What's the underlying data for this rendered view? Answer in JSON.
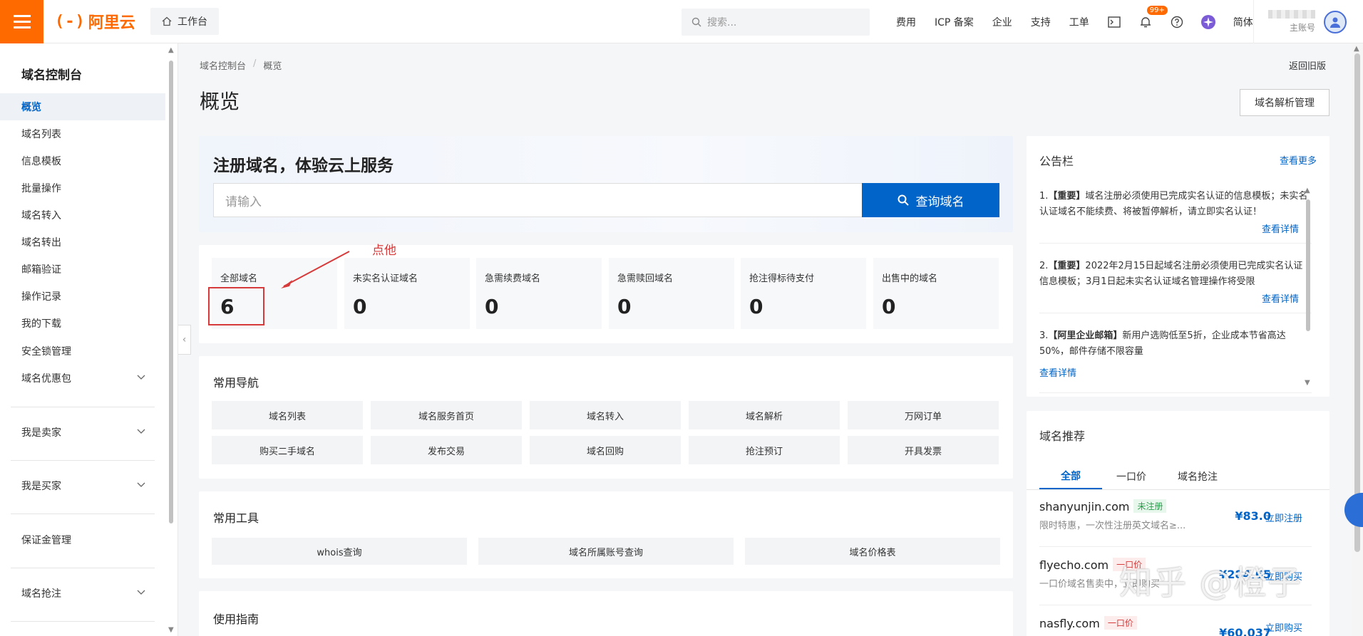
{
  "topbar": {
    "logo_mark": "(-)",
    "logo_text": "阿里云",
    "workbench": "工作台",
    "search_placeholder": "搜索...",
    "links": [
      "费用",
      "ICP 备案",
      "企业",
      "支持",
      "工单"
    ],
    "badge": "99+",
    "language": "简体",
    "account_role": "主账号"
  },
  "sidebar": {
    "title": "域名控制台",
    "items": [
      "概览",
      "域名列表",
      "信息模板",
      "批量操作",
      "域名转入",
      "域名转出",
      "邮箱验证",
      "操作记录",
      "我的下载",
      "安全锁管理",
      "域名优惠包"
    ],
    "groups": [
      "我是卖家",
      "我是买家",
      "保证金管理",
      "域名抢注"
    ],
    "collapse_glyph": "‹"
  },
  "main": {
    "breadcrumb": [
      "域名控制台",
      "/",
      "概览"
    ],
    "back_old": "返回旧版",
    "title": "概览",
    "dns_button": "域名解析管理",
    "register": {
      "title": "注册域名，体验云上服务",
      "placeholder": "请输入",
      "button": "查询域名"
    },
    "stats": [
      {
        "label": "全部域名",
        "value": "6"
      },
      {
        "label": "未实名认证域名",
        "value": "0"
      },
      {
        "label": "急需续费域名",
        "value": "0"
      },
      {
        "label": "急需赎回域名",
        "value": "0"
      },
      {
        "label": "抢注得标待支付",
        "value": "0"
      },
      {
        "label": "出售中的域名",
        "value": "0"
      }
    ],
    "annotation": "点他",
    "nav": {
      "title": "常用导航",
      "items": [
        "域名列表",
        "域名服务首页",
        "域名转入",
        "域名解析",
        "万网订单",
        "购买二手域名",
        "发布交易",
        "域名回购",
        "抢注预订",
        "开具发票"
      ]
    },
    "tools": {
      "title": "常用工具",
      "items": [
        "whois查询",
        "域名所属账号查询",
        "域名价格表"
      ]
    },
    "guide": {
      "title": "使用指南"
    }
  },
  "notice": {
    "title": "公告栏",
    "more": "查看更多",
    "detail": "查看详情",
    "items": [
      {
        "prefix": "1.",
        "tag": "【重要】",
        "text": "域名注册必须使用已完成实名认证的信息模板；未实名认证域名不能续费、将被暂停解析，请立即实名认证！"
      },
      {
        "prefix": "2.",
        "tag": "【重要】",
        "text": "2022年2月15日起域名注册必须使用已完成实名认证信息模板；3月1日起未实名认证域名管理操作将受限"
      },
      {
        "prefix": "3.",
        "tag": "【阿里企业邮箱】",
        "text": "新用户选购低至5折，企业成本节省高达50%，邮件存储不限容量"
      }
    ]
  },
  "recommend": {
    "title": "域名推荐",
    "tabs": [
      "全部",
      "一口价",
      "域名抢注"
    ],
    "rows": [
      {
        "domain": "shanyunjin.com",
        "tag": "未注册",
        "desc": "限时特惠，一次性注册英文域名≥...",
        "price": "¥83.0",
        "action": "立即注册"
      },
      {
        "domain": "flyecho.com",
        "tag": "一口价",
        "desc": "一口价域名售卖中，立即购买",
        "price": "¥284.65",
        "action": "立即购买"
      },
      {
        "domain": "nasfly.com",
        "tag": "一口价",
        "desc": "",
        "price": "¥60,037",
        "action": "立即购买"
      }
    ]
  },
  "watermark": "知乎 @橙子",
  "colors": {
    "brand": "#ff6a00",
    "primary": "#0064c8",
    "annotation": "#d63a3a"
  }
}
